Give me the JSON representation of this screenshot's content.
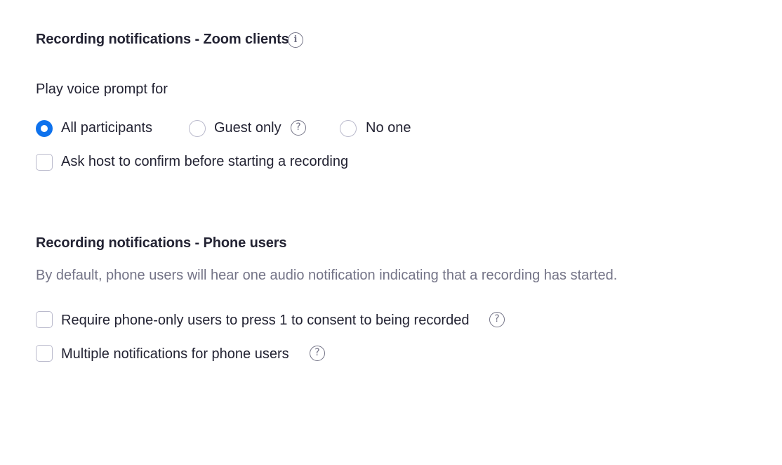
{
  "zoom_clients": {
    "title": "Recording notifications - Zoom clients",
    "info_icon": "info-icon",
    "voice_prompt_label": "Play voice prompt for",
    "options": [
      {
        "label": "All participants",
        "checked": true
      },
      {
        "label": "Guest only",
        "checked": false,
        "help_icon": "help-icon"
      },
      {
        "label": "No one",
        "checked": false
      }
    ],
    "confirm_checkbox": {
      "label": "Ask host to confirm before starting a recording",
      "checked": false
    }
  },
  "phone_users": {
    "title": "Recording notifications - Phone users",
    "description": "By default, phone users will hear one audio notification indicating that a recording has started.",
    "checkboxes": [
      {
        "label": "Require phone-only users to press 1 to consent to being recorded",
        "checked": false,
        "help_icon": "help-icon"
      },
      {
        "label": "Multiple notifications for phone users",
        "checked": false,
        "help_icon": "help-icon"
      }
    ]
  },
  "icons": {
    "help_glyph": "?",
    "info_glyph": "i"
  },
  "colors": {
    "accent": "#0e72ed",
    "text": "#232333",
    "muted": "#747487",
    "border": "#babacc"
  }
}
